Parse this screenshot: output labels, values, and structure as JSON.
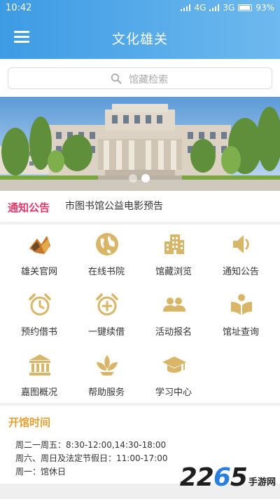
{
  "status_bar": {
    "time": "10:42",
    "network_1": "4G",
    "network_2": "3G",
    "battery": "93%"
  },
  "app_bar": {
    "title": "文化雄关",
    "menu_icon": "hamburger-icon"
  },
  "search": {
    "placeholder": "馆藏检索",
    "icon": "search-icon"
  },
  "banner": {
    "slide_count": 2,
    "active_slide": 2
  },
  "notice": {
    "tag": "通知公告",
    "headline": "市图书馆公益电影预告"
  },
  "features": [
    {
      "label": "雄关官网",
      "icon": "logo-icon"
    },
    {
      "label": "在线书院",
      "icon": "globe-icon"
    },
    {
      "label": "馆藏浏览",
      "icon": "building-icon"
    },
    {
      "label": "通知公告",
      "icon": "speaker-icon"
    },
    {
      "label": "预约借书",
      "icon": "alarm-clock-icon"
    },
    {
      "label": "一键续借",
      "icon": "alarm-plus-icon"
    },
    {
      "label": "活动报名",
      "icon": "users-icon"
    },
    {
      "label": "馆址查询",
      "icon": "book-reader-icon"
    },
    {
      "label": "嘉图概况",
      "icon": "institution-icon"
    },
    {
      "label": "帮助服务",
      "icon": "leaf-icon"
    },
    {
      "label": "学习中心",
      "icon": "graduation-cap-icon"
    }
  ],
  "hours": {
    "title": "开馆时间",
    "lines": [
      "周二一周五：8:30-12:00,14:30-18:00",
      "周六、周日及法定节假日：11:00-17:00",
      "周一：馆休日"
    ]
  },
  "watermark": {
    "number_a": "22",
    "number_b": "6",
    "number_c": "5",
    "site": "手游网"
  },
  "colors": {
    "primary": "#4aa7ea",
    "notice_tag": "#e2396a",
    "icon_gold": "#d9b567",
    "hours_title": "#e6a030"
  }
}
